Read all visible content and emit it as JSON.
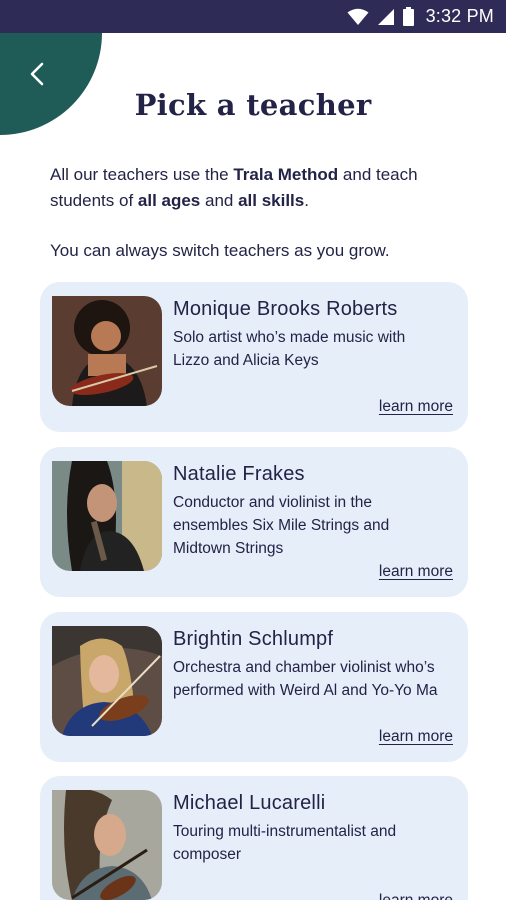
{
  "status_bar": {
    "time": "3:32 PM",
    "icons": [
      "wifi-icon",
      "cell-signal-icon",
      "battery-icon"
    ],
    "color": "#2f2b57"
  },
  "header": {
    "back_icon": "chevron-left-icon",
    "back_color": "#1f5c57",
    "title": "Pick a teacher"
  },
  "intro": {
    "p1_a": "All our teachers use the ",
    "p1_b": "Trala Method",
    "p1_c": " and teach students of ",
    "p1_d": "all ages",
    "p1_e": " and ",
    "p1_f": "all skills",
    "p1_g": ".",
    "p2": "You can always switch teachers as you grow."
  },
  "teachers": [
    {
      "name": "Monique Brooks Roberts",
      "bio": "Solo artist who’s made music with Lizzo and Alicia Keys",
      "learn_more": "learn more"
    },
    {
      "name": "Natalie Frakes",
      "bio": "Conductor and violinist in the ensembles Six Mile Strings and Midtown Strings",
      "learn_more": "learn more"
    },
    {
      "name": "Brightin Schlumpf",
      "bio": "Orchestra and chamber violinist who’s performed with Weird Al and Yo-Yo Ma",
      "learn_more": "learn more"
    },
    {
      "name": "Michael Lucarelli",
      "bio": "Touring multi-instrumentalist and composer",
      "learn_more": "learn more"
    }
  ],
  "colors": {
    "card_bg": "#e6eef9",
    "text": "#232347"
  }
}
